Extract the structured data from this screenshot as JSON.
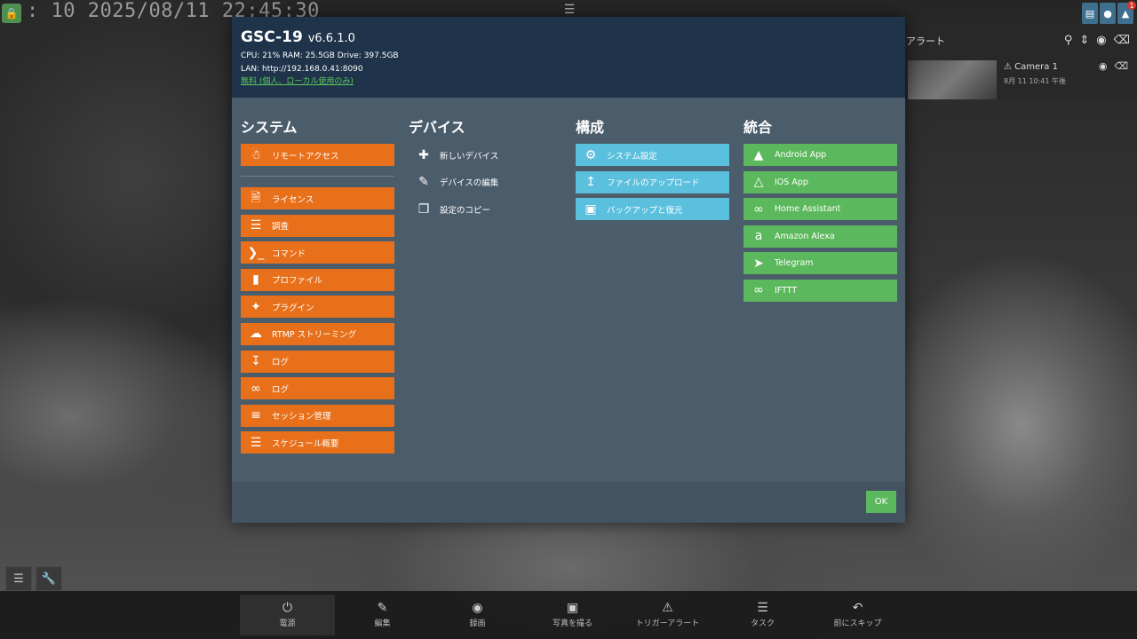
{
  "camera": {
    "timestamp": ": 10 2025/08/11 22:45:30"
  },
  "top_right": {
    "notification_count": "1"
  },
  "alerts": {
    "header": "アラート",
    "item": {
      "title": "Camera 1",
      "time": "8月 11 10:41 午後"
    }
  },
  "modal": {
    "app_name": "GSC-19",
    "version": "v6.6.1.0",
    "stats": "CPU: 21% RAM: 25.5GB Drive: 397.5GB",
    "lan": "LAN: http://192.168.0.41:8090",
    "license": "無料 (個人、ローカル使用のみ)",
    "ok_label": "OK",
    "columns": {
      "system": {
        "title": "システム",
        "top": [
          {
            "label": "リモートアクセス",
            "icon": "accessibility-icon"
          }
        ],
        "items": [
          {
            "label": "ライセンス",
            "icon": "license-icon"
          },
          {
            "label": "調査",
            "icon": "checklist-icon"
          },
          {
            "label": "コマンド",
            "icon": "terminal-icon"
          },
          {
            "label": "プロファイル",
            "icon": "bookmark-icon"
          },
          {
            "label": "プラグイン",
            "icon": "puzzle-icon"
          },
          {
            "label": "RTMP ストリーミング",
            "icon": "cloud-upload-icon"
          },
          {
            "label": "ログ",
            "icon": "download-icon"
          },
          {
            "label": "ログ",
            "icon": "link-icon"
          },
          {
            "label": "セッション管理",
            "icon": "list-icon"
          },
          {
            "label": "スケジュール概要",
            "icon": "checklist-icon"
          }
        ]
      },
      "devices": {
        "title": "デバイス",
        "items": [
          {
            "label": "新しいデバイス",
            "icon": "plus-icon"
          },
          {
            "label": "デバイスの編集",
            "icon": "edit-icon"
          },
          {
            "label": "設定のコピー",
            "icon": "copy-icon"
          }
        ]
      },
      "config": {
        "title": "構成",
        "items": [
          {
            "label": "システム設定",
            "icon": "gears-icon"
          },
          {
            "label": "ファイルのアップロード",
            "icon": "upload-icon"
          },
          {
            "label": "バックアップと復元",
            "icon": "save-icon"
          }
        ]
      },
      "integrations": {
        "title": "統合",
        "items": [
          {
            "label": "Android App",
            "icon": "android-icon"
          },
          {
            "label": "IOS App",
            "icon": "app-store-icon"
          },
          {
            "label": "Home Assistant",
            "icon": "link-icon"
          },
          {
            "label": "Amazon Alexa",
            "icon": "amazon-icon"
          },
          {
            "label": "Telegram",
            "icon": "telegram-icon"
          },
          {
            "label": "IFTTT",
            "icon": "link-icon"
          }
        ]
      }
    }
  },
  "bottom_bar": [
    {
      "label": "電源",
      "icon": "power-icon"
    },
    {
      "label": "編集",
      "icon": "edit-icon"
    },
    {
      "label": "録画",
      "icon": "record-icon"
    },
    {
      "label": "写真を撮る",
      "icon": "camera-icon"
    },
    {
      "label": "トリガーアラート",
      "icon": "warning-icon"
    },
    {
      "label": "タスク",
      "icon": "checklist-icon"
    },
    {
      "label": "前にスキップ",
      "icon": "undo-icon"
    }
  ]
}
